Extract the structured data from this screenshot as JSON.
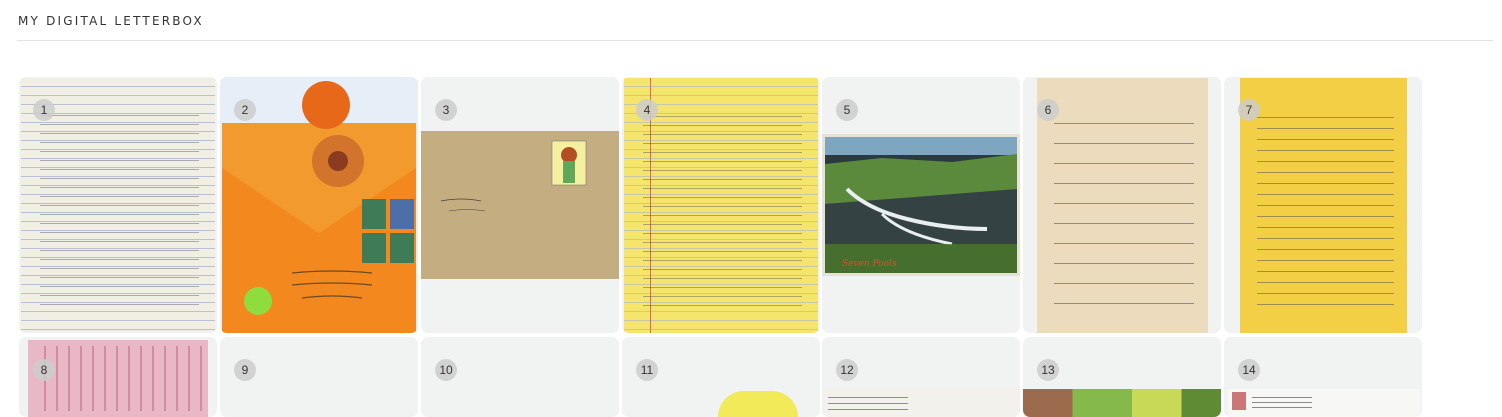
{
  "header": {
    "title": "MY DIGITAL LETTERBOX"
  },
  "letters": [
    {
      "number": "1",
      "icon": "handwritten-letter-lined-paper"
    },
    {
      "number": "2",
      "icon": "orange-envelope-with-stamps"
    },
    {
      "number": "3",
      "icon": "card-with-girl-illustration"
    },
    {
      "number": "4",
      "icon": "yellow-legal-pad-letter"
    },
    {
      "number": "5",
      "icon": "postcard-waterfall-photo"
    },
    {
      "number": "6",
      "icon": "handwritten-letter-cream-paper"
    },
    {
      "number": "7",
      "icon": "handwritten-letter-yellow-paper"
    },
    {
      "number": "8",
      "icon": "pink-stamped-paper"
    },
    {
      "number": "9",
      "icon": "empty-tile"
    },
    {
      "number": "10",
      "icon": "empty-tile"
    },
    {
      "number": "11",
      "icon": "yellow-flower-photo"
    },
    {
      "number": "12",
      "icon": "postcard-handwriting"
    },
    {
      "number": "13",
      "icon": "colorful-photo-collage"
    },
    {
      "number": "14",
      "icon": "typed-letter"
    }
  ]
}
